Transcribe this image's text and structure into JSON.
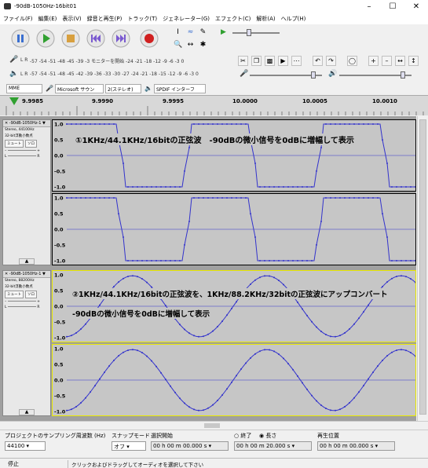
{
  "window": {
    "title": "-90dB-1050Hz-16bit01"
  },
  "menu": [
    "ファイル(F)",
    "編集(E)",
    "表示(V)",
    "録音と再生(P)",
    "トラック(T)",
    "ジェネレーター(G)",
    "エフェクト(C)",
    "解析(A)",
    "ヘルプ(H)"
  ],
  "meters": {
    "record_scale": "-57 -54 -51 -48 -45  -39 -3 モニターを開始 -24 -21 -18  -12 -9 -6 -3 0",
    "play_scale": "-57 -54 -51 -48 -45 -42 -39 -36 -33 -30 -27 -24 -21 -18 -15 -12 -9 -6 -3 0",
    "rec_lr": "L R",
    "play_lr": "L R"
  },
  "devices": {
    "host": "MME",
    "input": "Microsoft サウン",
    "channels": "2(ステレオ)",
    "output": "SPDIF インターフ"
  },
  "ruler": {
    "labels": [
      "9.9985",
      "9.9990",
      "9.9995",
      "10.0000",
      "10.0005",
      "10.0010"
    ]
  },
  "tracks": [
    {
      "name": "-90dB-1050Hz-1",
      "info1": "Stereo, 44100Hz",
      "info2": "32-bit浮動小数点",
      "mute": "ミュート",
      "solo": "ソロ",
      "annotation": "①1KHz/44.1KHz/16bitの正弦波　-90dBの微小信号を0dBに増幅して表示",
      "yticks": [
        "1.0",
        "0.5",
        "0.0",
        "-0.5",
        "-1.0"
      ]
    },
    {
      "name": "-90dB-1050Hz-1",
      "info1": "Stereo, 88200Hz",
      "info2": "32-bit浮動小数点",
      "mute": "ミュート",
      "solo": "ソロ",
      "annotation1": "②1KHz/44.1KHz/16bitの正弦波を、1KHz/88.2KHz/32bitの正弦波にアップコンバート",
      "annotation2": "-90dBの微小信号を0dBに増幅して表示",
      "yticks": [
        "1.0",
        "0.5",
        "0.0",
        "-0.5",
        "-1.0"
      ]
    }
  ],
  "selection_toolbar": {
    "rate_label": "プロジェクトのサンプリング周波数 (Hz)",
    "rate_value": "44100",
    "snap_label": "スナップモード",
    "snap_value": "オフ",
    "start_label": "選択開始",
    "end_label": "終了",
    "length_label": "長さ",
    "start_value": "00 h 00 m 00.000 s",
    "length_value": "00 h 00 m 20.000 s",
    "playpos_label": "再生位置",
    "playpos_value": "00 h 00 m 00.000 s"
  },
  "status": {
    "left": "停止",
    "right": "クリックおよびドラッグしてオーディオを選択して下さい"
  },
  "colors": {
    "wave": "#3333cc",
    "wave_bg": "#c6c6c6",
    "play_green": "#30a030",
    "record_red": "#d02020",
    "pause_blue": "#3a6fd0"
  }
}
